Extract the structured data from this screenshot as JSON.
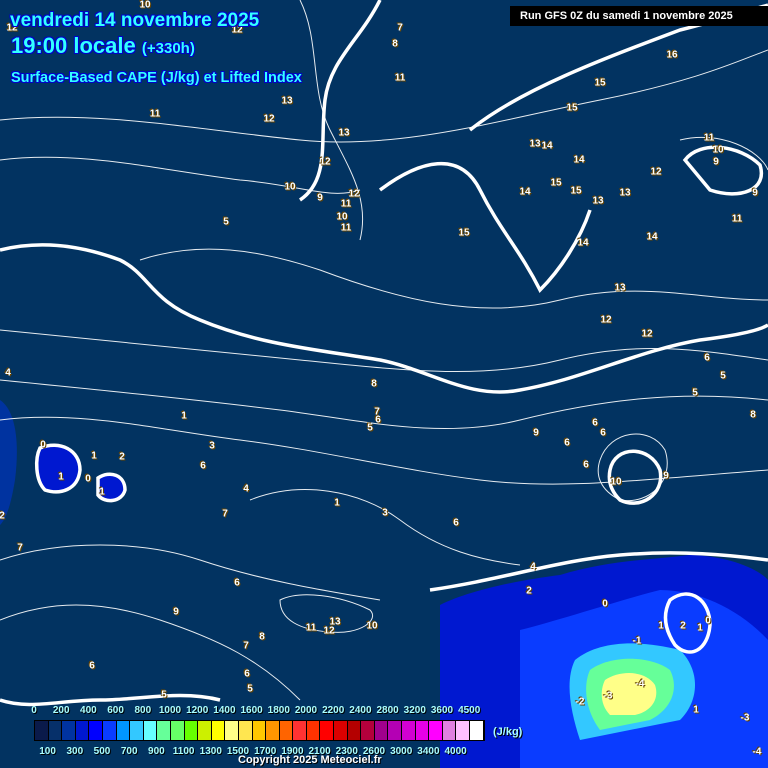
{
  "header": {
    "date": "vendredi 14 novembre 2025",
    "time": "19:00 locale",
    "lead": "(+330h)",
    "parameter": "Surface-Based CAPE (J/kg) et Lifted Index",
    "run": "Run GFS 0Z du samedi 1 novembre 2025"
  },
  "colorbar": {
    "unit": "(J/kg)",
    "top_labels": [
      "0",
      "200",
      "400",
      "600",
      "800",
      "1000",
      "1200",
      "1400",
      "1600",
      "1800",
      "2000",
      "2200",
      "2400",
      "2800",
      "3200",
      "3600",
      "4500"
    ],
    "bottom_labels": [
      "100",
      "300",
      "500",
      "700",
      "900",
      "1100",
      "1300",
      "1500",
      "1700",
      "1900",
      "2100",
      "2300",
      "2600",
      "3000",
      "3400",
      "4000"
    ],
    "colors": [
      "#0a1a4a",
      "#06306a",
      "#0033a0",
      "#0018d0",
      "#0000ff",
      "#0a3cff",
      "#0096ff",
      "#33c8ff",
      "#66ffff",
      "#66ff99",
      "#66ff66",
      "#66ff00",
      "#ccf000",
      "#ffff00",
      "#ffff88",
      "#ffe650",
      "#ffc800",
      "#ff9600",
      "#ff6400",
      "#ff3232",
      "#ff3200",
      "#ff0000",
      "#dc0000",
      "#b40000",
      "#b4003c",
      "#a0008c",
      "#b400b4",
      "#d200d2",
      "#e600e6",
      "#ff00ff",
      "#e080e0",
      "#ffc0ff",
      "#ffffff"
    ]
  },
  "contour_labels": [
    "12",
    "10",
    "7",
    "8",
    "12",
    "11",
    "16",
    "15",
    "15",
    "13",
    "12",
    "11",
    "13",
    "14",
    "11",
    "10",
    "9",
    "12",
    "11",
    "12",
    "10",
    "9",
    "10",
    "11",
    "12",
    "14",
    "15",
    "15",
    "13",
    "9",
    "14",
    "5",
    "15",
    "13",
    "14",
    "14",
    "11",
    "13",
    "12",
    "13",
    "12",
    "4",
    "8",
    "7",
    "5",
    "6",
    "5",
    "6",
    "5",
    "8",
    "1",
    "9",
    "6",
    "6",
    "3",
    "6",
    "6",
    "10",
    "9",
    "0",
    "2",
    "1",
    "0",
    "1",
    "1",
    "4",
    "6",
    "7",
    "1",
    "3",
    "6",
    "4",
    "5",
    "2",
    "2",
    "7",
    "6",
    "9",
    "12",
    "10",
    "11",
    "13",
    "8",
    "7",
    "6",
    "6",
    "5",
    "0",
    "1",
    "2",
    "0",
    "-1",
    "-2",
    "-3",
    "-4",
    "1",
    "-4",
    "-3",
    "1"
  ],
  "footer": {
    "copyright": "Copyright 2025 Meteociel.fr"
  }
}
